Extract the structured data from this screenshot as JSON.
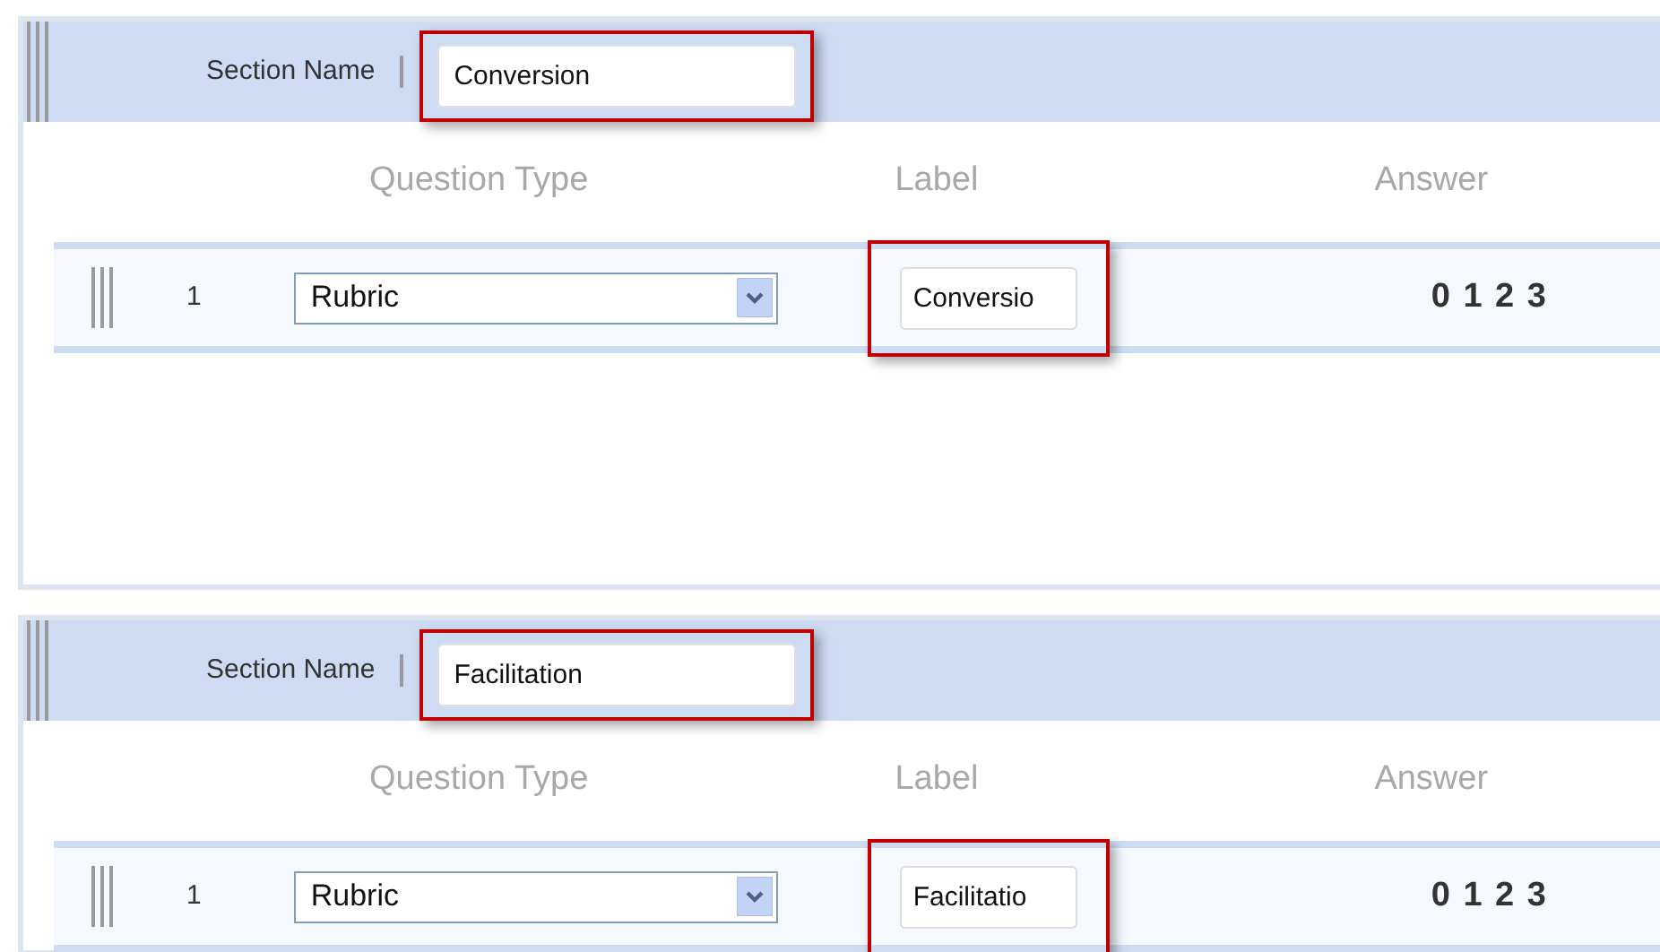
{
  "sections": [
    {
      "label": "Section Name",
      "name": "Conversion",
      "columns": [
        "Question Type",
        "Label",
        "Answer"
      ],
      "questions": [
        {
          "number": "1",
          "type": "Rubric",
          "label": "Conversio",
          "answer": "0 1 2 3"
        }
      ]
    },
    {
      "label": "Section Name",
      "name": "Facilitation",
      "columns": [
        "Question Type",
        "Label",
        "Answer"
      ],
      "questions": [
        {
          "number": "1",
          "type": "Rubric",
          "label": "Facilitatio",
          "answer": "0 1 2 3"
        }
      ]
    }
  ]
}
